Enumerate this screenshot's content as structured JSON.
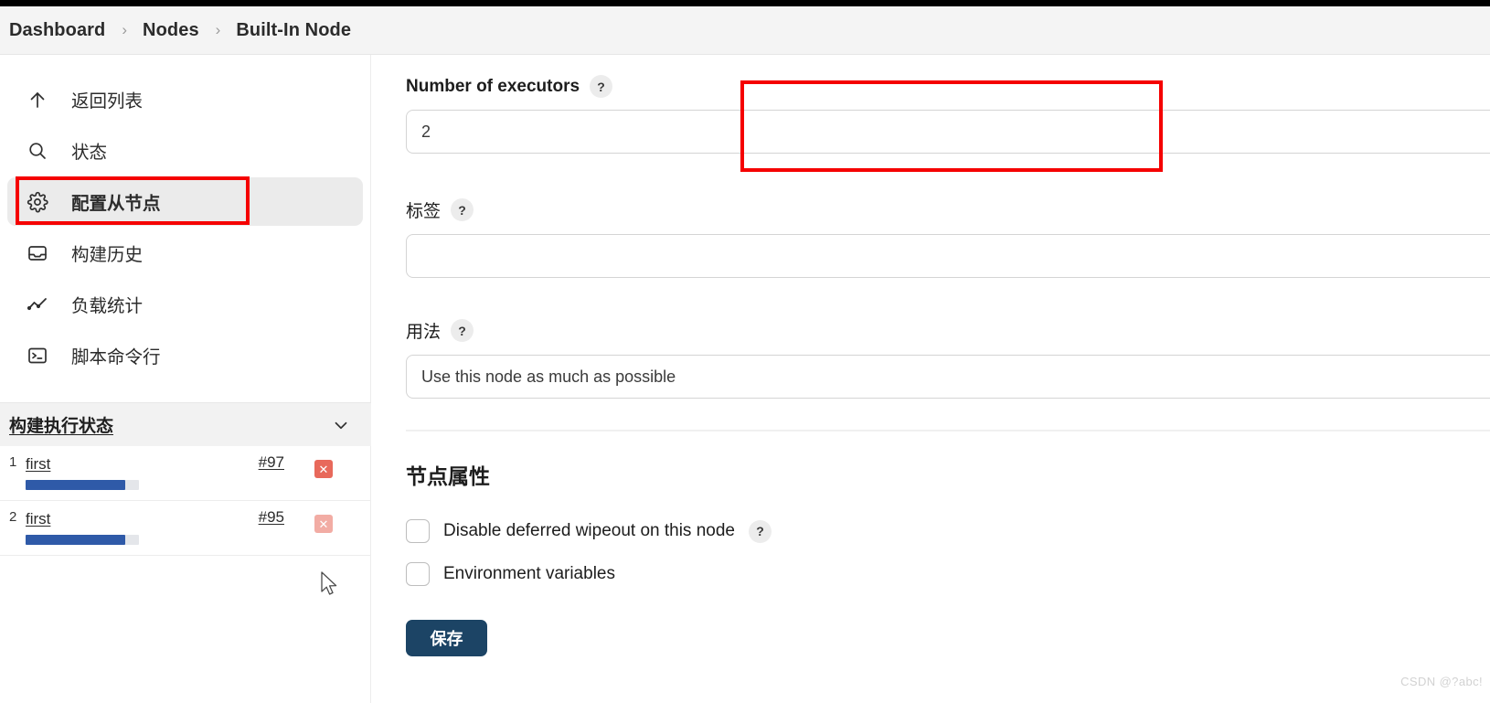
{
  "breadcrumb": {
    "items": [
      {
        "label": "Dashboard"
      },
      {
        "label": "Nodes"
      },
      {
        "label": "Built-In Node"
      }
    ],
    "separator": "›"
  },
  "sidebar": {
    "items": [
      {
        "label": "返回列表",
        "icon": "arrow-up-icon",
        "active": false
      },
      {
        "label": "状态",
        "icon": "search-icon",
        "active": false
      },
      {
        "label": "配置从节点",
        "icon": "gear-icon",
        "active": true
      },
      {
        "label": "构建历史",
        "icon": "inbox-icon",
        "active": false
      },
      {
        "label": "负载统计",
        "icon": "line-chart-icon",
        "active": false
      },
      {
        "label": "脚本命令行",
        "icon": "terminal-icon",
        "active": false
      }
    ],
    "executors": {
      "title": "构建执行状态",
      "collapse_icon": "chevron-down-icon",
      "rows": [
        {
          "num": "1",
          "job": "first",
          "build": "#97",
          "progress": 88,
          "cancel_icon": "cancel-x-icon"
        },
        {
          "num": "2",
          "job": "first",
          "build": "#95",
          "progress": 88,
          "cancel_icon": "cancel-x-icon"
        }
      ]
    }
  },
  "main": {
    "executors_field": {
      "label": "Number of executors",
      "help": "?",
      "value": "2"
    },
    "labels_field": {
      "label": "标签",
      "help": "?",
      "value": "",
      "placeholder": ""
    },
    "usage_field": {
      "label": "用法",
      "help": "?",
      "value": "Use this node as much as possible"
    },
    "node_properties": {
      "title": "节点属性",
      "checkboxes": [
        {
          "label": "Disable deferred wipeout on this node",
          "help": "?",
          "checked": false,
          "has_help": true
        },
        {
          "label": "Environment variables",
          "help": "",
          "checked": false,
          "has_help": false
        }
      ]
    },
    "save_button": "保存"
  },
  "annotations": {
    "color": "#f50000",
    "boxes": [
      {
        "target": "sidebar-config-item"
      },
      {
        "target": "number-of-executors-field"
      }
    ]
  },
  "watermark": "CSDN @?abc!",
  "colors": {
    "accent_save": "#1c4465",
    "progress_bar": "#2f5aa8",
    "cancel": "#e8695b",
    "annotation": "#f50000",
    "active_nav_bg": "#ebebeb"
  }
}
